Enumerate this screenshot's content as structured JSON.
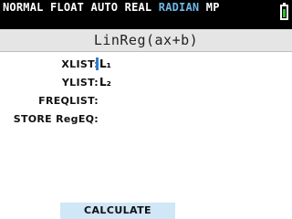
{
  "status": {
    "mode_text": "NORMAL FLOAT AUTO REAL ",
    "angle_mode": "RADIAN",
    "suffix": " MP",
    "radian_color": "#6fb8e6",
    "battery_color": "#2fbf3a"
  },
  "screen_title": "LinReg(ax+b)",
  "fields": {
    "xlist": {
      "label": "XLIST:",
      "value": "L₁"
    },
    "ylist": {
      "label": "YLIST:",
      "value": "L₂"
    },
    "freqlist": {
      "label": "FREQLIST:",
      "value": ""
    },
    "store_regeq": {
      "label": "STORE RegEQ:",
      "value": ""
    }
  },
  "calculate_label": "CALCULATE"
}
